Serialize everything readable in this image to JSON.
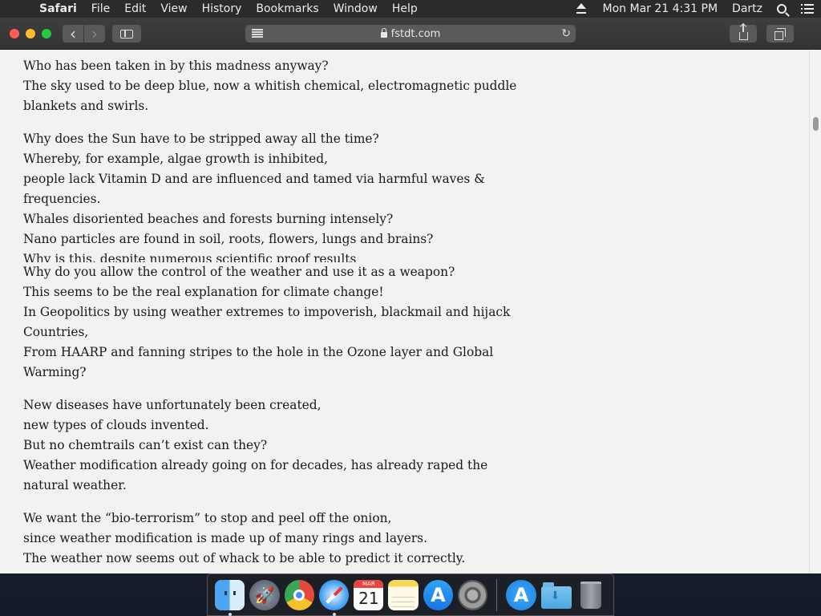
{
  "menubar": {
    "apple_glyph": "",
    "app_name": "Safari",
    "menus": [
      "File",
      "Edit",
      "View",
      "History",
      "Bookmarks",
      "Window",
      "Help"
    ],
    "datetime": "Mon Mar 21  4:31 PM",
    "user": "Dartz"
  },
  "browser": {
    "url": "fstdt.com",
    "reload_glyph": "↻",
    "back_glyph": "‹",
    "forward_glyph": "›",
    "new_tab_glyph": "+"
  },
  "article": {
    "lines": [
      {
        "type": "line",
        "text": "Who has been taken in by this madness anyway?"
      },
      {
        "type": "line",
        "text": "The sky used to be deep blue, now a whitish chemical, electromagnetic puddle"
      },
      {
        "type": "line",
        "text": "blankets and swirls."
      },
      {
        "type": "gap"
      },
      {
        "type": "line",
        "text": "Why does the Sun have to be stripped away all the time?"
      },
      {
        "type": "line",
        "text": "Whereby, for example, algae growth is inhibited,"
      },
      {
        "type": "line",
        "text": "people lack Vitamin D and are influenced and tamed via harmful waves &"
      },
      {
        "type": "line",
        "text": "frequencies."
      },
      {
        "type": "line",
        "text": "Whales disoriented beaches and forests burning intensely?"
      },
      {
        "type": "line",
        "text": "Nano particles are found in soil, roots, flowers, lungs and brains?"
      },
      {
        "type": "glitch",
        "text": "Why is this, despite numerous scientific proof results"
      },
      {
        "type": "line",
        "text": "Why do you allow the control of the weather and use it as a weapon?"
      },
      {
        "type": "line",
        "text": "This seems to be the real explanation for climate change!"
      },
      {
        "type": "line",
        "text": "In Geopolitics by using weather extremes to impoverish, blackmail and hijack"
      },
      {
        "type": "line",
        "text": "Countries,"
      },
      {
        "type": "line",
        "text": "From HAARP and fanning stripes to the hole in the Ozone layer and Global"
      },
      {
        "type": "line",
        "text": "Warming?"
      },
      {
        "type": "gap"
      },
      {
        "type": "line",
        "text": "New diseases have unfortunately been created,"
      },
      {
        "type": "line",
        "text": "new types of clouds invented."
      },
      {
        "type": "line",
        "text": "But no chemtrails can’t exist can they?"
      },
      {
        "type": "line",
        "text": "Weather modification already going on for decades, has already raped the"
      },
      {
        "type": "line",
        "text": "natural weather."
      },
      {
        "type": "gap"
      },
      {
        "type": "line",
        "text": "We want the “bio-terrorism” to stop and peel off the onion,"
      },
      {
        "type": "line",
        "text": "since weather modification is made up of many rings and layers."
      },
      {
        "type": "line",
        "text": "The weather now seems out of whack to be able to predict it correctly."
      }
    ]
  },
  "dock": {
    "items": [
      {
        "name": "finder-icon",
        "kind": "finder",
        "running": true
      },
      {
        "name": "launchpad-icon",
        "kind": "launchpad",
        "running": false
      },
      {
        "name": "chrome-icon",
        "kind": "chrome",
        "running": false
      },
      {
        "name": "safari-icon",
        "kind": "safari",
        "running": true
      },
      {
        "name": "calendar-icon",
        "kind": "calendar",
        "running": false,
        "month": "MAR",
        "day": "21"
      },
      {
        "name": "notes-icon",
        "kind": "notes",
        "running": false
      },
      {
        "name": "app-store-icon",
        "kind": "appstore",
        "running": false
      },
      {
        "name": "system-preferences-icon",
        "kind": "prefs",
        "running": false
      }
    ],
    "right_items": [
      {
        "name": "app-store-downloads-icon",
        "kind": "downloads"
      },
      {
        "name": "downloads-folder-icon",
        "kind": "folder"
      },
      {
        "name": "trash-icon",
        "kind": "trash"
      }
    ]
  }
}
